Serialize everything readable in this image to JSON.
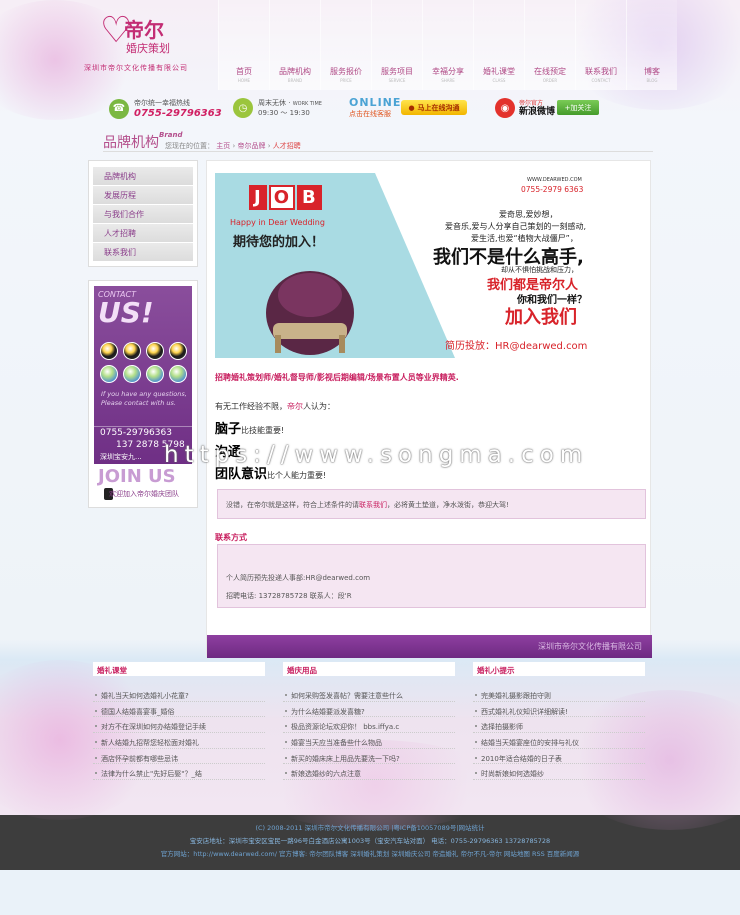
{
  "logo": {
    "brand": "帝尔",
    "sub": "婚庆策划",
    "company": "深圳市帝尔文化传播有限公司"
  },
  "nav": [
    {
      "label": "首页",
      "en": "HOME"
    },
    {
      "label": "品牌机构",
      "en": "BRAND"
    },
    {
      "label": "服务报价",
      "en": "PRICE"
    },
    {
      "label": "服务项目",
      "en": "SERVICE"
    },
    {
      "label": "幸福分享",
      "en": "SHARE"
    },
    {
      "label": "婚礼课堂",
      "en": "CLASS"
    },
    {
      "label": "在线预定",
      "en": "ORDER"
    },
    {
      "label": "联系我们",
      "en": "CONTACT"
    },
    {
      "label": "博客",
      "en": "BLOG"
    }
  ],
  "infobar": {
    "hotline_label": "帝尔统一幸福热线",
    "hotline": "0755-29796363",
    "work_label": "周末无休",
    "work_en": "WORK TIME",
    "work_time": "09:30 ～ 19:30",
    "online": "ONLINE",
    "online_sub": "点击在线客服",
    "chat_button": "马上在线沟通",
    "weibo_label": "帝尔官方",
    "weibo_name": "新浪微博",
    "follow_button": "+加关注"
  },
  "pagehead": {
    "title": "品牌机构",
    "title_en": "Brand",
    "crumb_prefix": "您现在的位置：",
    "crumb_home": "主页",
    "crumb_sep1": "›",
    "crumb_mid": "帝尔品牌",
    "crumb_sep2": "›",
    "crumb_current": "人才招聘"
  },
  "sidebar": {
    "items": [
      "品牌机构",
      "发展历程",
      "与我们合作",
      "人才招聘",
      "联系我们"
    ],
    "contact_small": "CONTACT",
    "contact_big": "US!",
    "msg1": "If you have any questions,",
    "msg2": "Please contact with us.",
    "tel1": "0755-29796363",
    "tel2": "137 2878 5798",
    "addr": "深圳宝安九...",
    "join_big": "JOIN US",
    "join_small": "欢迎加入帝尔婚庆团队"
  },
  "banner": {
    "job": [
      "J",
      "O",
      "B"
    ],
    "happy": "Happy in Dear Wedding",
    "expect": "期待您的加入！",
    "www": "WWW.DEARWED.COM",
    "tel": "0755-2979 6363",
    "line1": "爱奇思,爱妙想，",
    "line2": "爱音乐,爱与人分享自己策划的一刻感动,",
    "line3": "爱生活,也爱“植物大战僵尸”，",
    "big1": "我们不是什么高手,",
    "line4": "却从不惧怕挑战和压力，",
    "big2": "我们都是帝尔人",
    "line5": "你和我们一样？",
    "big3": "加入我们",
    "hr": "简历投放：HR@dearwed.com"
  },
  "main": {
    "positions": "招聘婚礼策划师/婚礼督导师/影视后期编辑/场景布置人员等业界精英.",
    "question_pre": "有无工作经验不限，",
    "question_brand": "帝尔",
    "question_post": "人认为：",
    "kw1": "脑子",
    "kw1_small": "比技能重要!",
    "kw2": "沟通",
    "kw3": "团队意识",
    "kw3_small": "比个人能力重要!",
    "note_pre": "没错，在帝尔就是这样，符合上述条件的请",
    "note_link": "联系我们",
    "note_post": "，必将黄土垫道，净水泼街，恭迎大驾!",
    "contact_title": "联系方式",
    "contact_a": "个人简历预先投递人事部:HR@dearwed.com",
    "contact_b": "招聘电话: 13728785728    联系人：段'R",
    "footer": "深圳市帝尔文化传播有限公司"
  },
  "columns": [
    {
      "title": "婚礼课堂",
      "items": [
        "婚礼当天如何选婚礼小花童?",
        "德国人结婚喜宴事_婚俗",
        "对方不在深圳如何办结婚登记手续",
        "新人结婚九招帮您轻松面对婚礼",
        "酒店怀孕前都有哪些忌讳",
        "法律为什么禁止\"先好后娶\"？_结"
      ]
    },
    {
      "title": "婚庆用品",
      "items": [
        "如何采购签发喜帖？需要注意些什么",
        "为什么结婚要派发喜糖?",
        "极品资源论坛欢迎你！ bbs.iffya.c",
        "婚宴当天应当准备些什么物品",
        "新买的婚床床上用品先要洗一下吗?",
        "新娘选婚纱的六点注意"
      ]
    },
    {
      "title": "婚礼小提示",
      "items": [
        "完美婚礼摄影跟拍守则",
        "西式婚礼礼仪知识详细解读!",
        "选择拍摄影师",
        "结婚当天婚宴座位的安排与礼仪",
        "2010年适合结婚的日子表",
        "时尚新娘如何选婚纱"
      ]
    }
  ],
  "footer": {
    "line1": "(C) 2008-2011 深圳市帝尔文化传播有限公司 |粤ICP备10057089号|网站统计",
    "line2": "宝安店地址：深圳市宝安区宝民一路96号白金酒店公寓1003号（宝安汽车站对面）      电话：0755-29796363  13728785728",
    "line3": "官方网站：http://www.dearwed.com/ 官方博客: 帝尔团队博客 深圳婚礼策划 深圳婚庆公司 帝造婚礼 帝尔不凡-帝尔 网站地图 RSS 百度新闻源"
  },
  "watermark": "https://www.songma.com"
}
